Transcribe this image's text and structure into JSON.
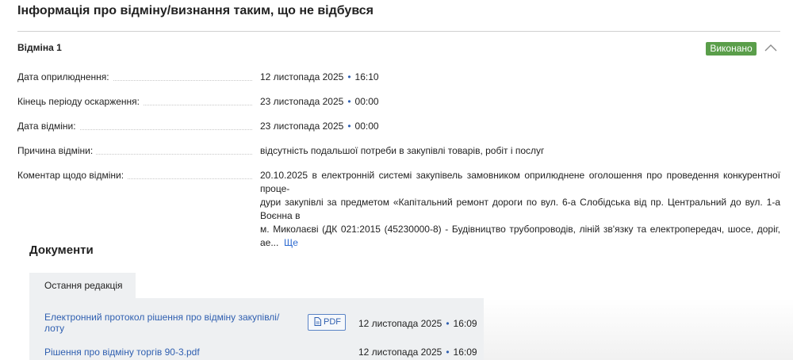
{
  "section": {
    "title": "Інформація про відміну/визнання таким, що не відбувся"
  },
  "cancellation": {
    "title": "Відміна 1",
    "status": "Виконано",
    "rows": [
      {
        "label": "Дата оприлюднення:",
        "date": "12 листопада 2025",
        "time": "16:10"
      },
      {
        "label": "Кінець періоду оскарження:",
        "date": "23 листопада 2025",
        "time": "00:00"
      },
      {
        "label": "Дата відміни:",
        "date": "23 листопада 2025",
        "time": "00:00"
      }
    ],
    "reason": {
      "label": "Причина відміни:",
      "value": "відсутність подальшої потреби в закупівлі товарів, робіт і послуг"
    },
    "comment": {
      "label": "Коментар щодо відміни:",
      "line1": "20.10.2025 в електронній системі закупівель замовником оприлюднене оголошення про проведення конкурентної проце-",
      "line2": "дури закупівлі за предметом «Капітальний ремонт дороги по вул. 6-а Слобідська від пр. Центральний до вул. 1-а Воєнна в",
      "line3": "м. Миколаєві (ДК 021:2015 (45230000-8) - Будівництво трубопроводів, ліній зв'язку та електропередач, шосе, доріг, ае...",
      "more": "Ще"
    }
  },
  "documents": {
    "title": "Документи",
    "tab": "Остання редакція",
    "items": [
      {
        "name": "Електронний протокол рішення про відміну закупівлі/ лоту",
        "badge": "PDF",
        "date": "12 листопада 2025",
        "time": "16:09"
      },
      {
        "name": "Рішення про відміну торгів 90-3.pdf",
        "date": "12 листопада 2025",
        "time": "16:09"
      }
    ]
  },
  "separator": "•",
  "colors": {
    "status_green": "#5a9e4a",
    "link_blue": "#2f5fb0",
    "panel_bg": "#eef0f2"
  },
  "icons": {
    "collapse": "chevron-up-icon",
    "pdf": "file-icon"
  }
}
